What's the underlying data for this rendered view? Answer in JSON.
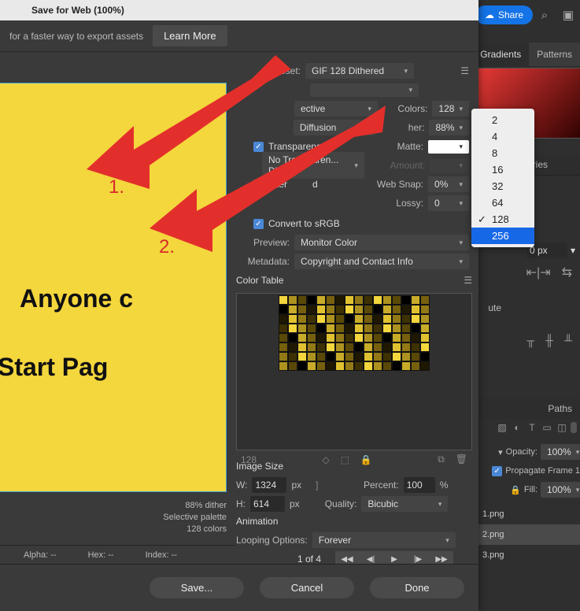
{
  "toolbar_right": {
    "share": "Share",
    "tabs": [
      "Gradients",
      "Patterns"
    ],
    "libraries": "Libraries",
    "distribute_label": "ute",
    "paths_tab": "Paths"
  },
  "dialog": {
    "title": "Save for Web (100%)",
    "tip": "for a faster way to export assets",
    "learn_more": "Learn More",
    "preset_label": "Preset:",
    "preset_value": "GIF 128 Dithered",
    "format_value": "",
    "reduction_value": "ective",
    "colors_label": "Colors:",
    "colors_value": "128",
    "dither_value": "Diffusion",
    "dither_label": "her:",
    "dither_pct": "88%",
    "transparency_label": "Transparency",
    "matte_label": "Matte:",
    "notrans_value": "No Transparen... Dith...",
    "amount_label": "Amount:",
    "interlaced_label": "Inter",
    "interlaced_label2": "d",
    "websnap_label": "Web Snap:",
    "websnap_value": "0%",
    "lossy_label": "Lossy:",
    "lossy_value": "0",
    "convert_label": "Convert to sRGB",
    "preview_label": "Preview:",
    "preview_value": "Monitor Color",
    "metadata_label": "Metadata:",
    "metadata_value": "Copyright and Contact Info",
    "color_table_label": "Color Table",
    "color_count": "128",
    "image_size_label": "Image Size",
    "W": "W:",
    "W_val": "1324",
    "H": "H:",
    "H_val": "614",
    "px": "px",
    "percent_label": "Percent:",
    "percent_val": "100",
    "pct_sign": "%",
    "quality_label": "Quality:",
    "quality_value": "Bicubic",
    "animation_label": "Animation",
    "loop_label": "Looping Options:",
    "loop_value": "Forever",
    "frame": "1 of 4",
    "save": "Save...",
    "cancel": "Cancel",
    "done": "Done"
  },
  "preview_text": {
    "line1": "Anyone c",
    "line2": "ith Start Pag",
    "meta1": "88% dither",
    "meta2": "Selective palette",
    "meta3": "128 colors"
  },
  "status": {
    "alpha": "Alpha: --",
    "hex": "Hex: --",
    "index": "Index: --"
  },
  "annotations": {
    "n1": "1.",
    "n2": "2."
  },
  "colors_popup": [
    "2",
    "4",
    "8",
    "16",
    "32",
    "64",
    "128",
    "256"
  ],
  "layers": {
    "opacity_label": "Opacity:",
    "opacity_val": "100%",
    "propagate": "Propagate Frame 1",
    "fill_label": "Fill:",
    "fill_val": "100%",
    "files": [
      "1.png",
      "2.png",
      "3.png"
    ]
  },
  "prop_px": "0 px"
}
